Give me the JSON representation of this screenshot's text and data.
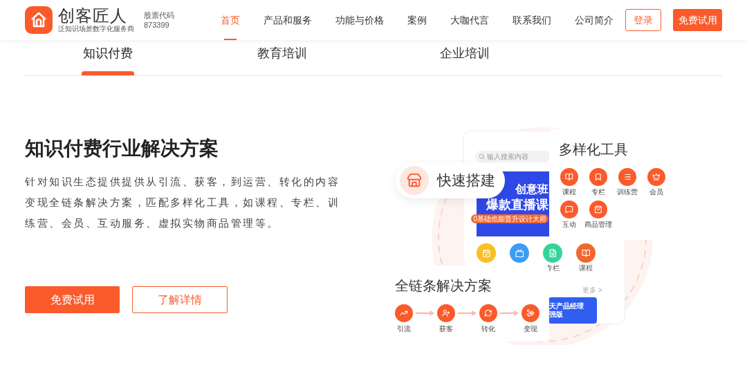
{
  "header": {
    "logo": {
      "name": "创客匠人",
      "slogan": "泛知识场景数字化服务商"
    },
    "stock": {
      "label": "股票代码",
      "code": "873399"
    },
    "nav": [
      {
        "label": "首页",
        "selected": true
      },
      {
        "label": "产品和服务",
        "selected": false
      },
      {
        "label": "功能与价格",
        "selected": false
      },
      {
        "label": "案例",
        "selected": false
      },
      {
        "label": "大咖代言",
        "selected": false
      },
      {
        "label": "联系我们",
        "selected": false
      },
      {
        "label": "公司简介",
        "selected": false
      }
    ],
    "login": "登录",
    "trial": "免费试用"
  },
  "tabs": [
    {
      "label": "知识付费",
      "selected": true
    },
    {
      "label": "教育培训",
      "selected": false
    },
    {
      "label": "企业培训",
      "selected": false
    }
  ],
  "hero": {
    "title": "知识付费行业解决方案",
    "description": "针对知识生态提供提供从引流、获客，到运营、转化的内容变现全链条解决方案，匹配多样化工具，如课程、专栏、训练营、会员、互动服务、虚拟实物商品管理等。",
    "primary": "免费试用",
    "secondary": "了解详情"
  },
  "illustration": {
    "phone": {
      "search_placeholder": "输入搜索内容",
      "banner_line1": "创意班",
      "banner_line2": "爆款直播课",
      "banner_tag": "0基础也能晋升设计大师",
      "icons": [
        {
          "kind": "calendar"
        },
        {
          "kind": "tv"
        },
        {
          "kind": "note",
          "label": "专栏"
        },
        {
          "kind": "book",
          "label": "课程"
        }
      ],
      "more": "更多 >",
      "banner2_line1": "天产品经理",
      "banner2_line2": "强版"
    },
    "quick": {
      "title": "快速搭建"
    },
    "tools": {
      "title": "多样化工具",
      "items": [
        {
          "kind": "book",
          "label": "课程"
        },
        {
          "kind": "bookmark",
          "label": "专栏"
        },
        {
          "kind": "list",
          "label": "训练营"
        },
        {
          "kind": "crown",
          "label": "会员"
        },
        {
          "kind": "chat",
          "label": "互动"
        },
        {
          "kind": "bag",
          "label": "商品管理"
        }
      ]
    },
    "chain": {
      "title": "全链条解决方案",
      "steps": [
        {
          "kind": "chart",
          "label": "引流"
        },
        {
          "kind": "user",
          "label": "获客"
        },
        {
          "kind": "refresh",
          "label": "转化"
        },
        {
          "kind": "hand",
          "label": "变现"
        }
      ]
    }
  }
}
